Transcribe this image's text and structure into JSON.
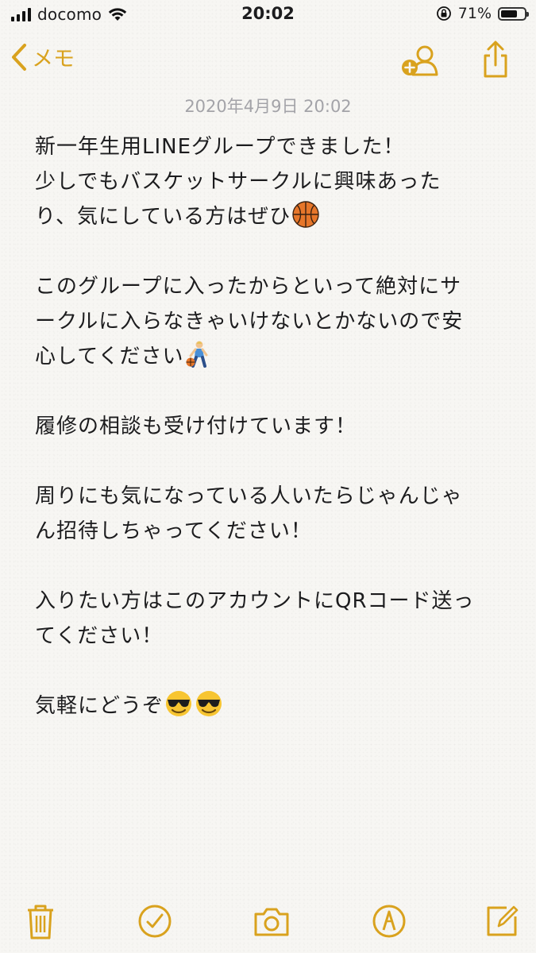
{
  "status_bar": {
    "carrier": "docomo",
    "time": "20:02",
    "battery_percent": "71%",
    "battery_level": 0.71,
    "signal_bars": 4
  },
  "nav": {
    "back_label": "メモ"
  },
  "note": {
    "date": "2020年4月9日 20:02",
    "paragraphs": [
      {
        "lines": [
          "新一年生用LINEグループできました！",
          "少しでもバスケットサークルに興味あった",
          "り、気にしている方はぜひ"
        ]
      },
      {
        "lines": [
          "このグループに入ったからといって絶対にサ",
          "ークルに入らなきゃいけないとかないので安",
          "心してください"
        ]
      },
      {
        "lines": [
          "履修の相談も受け付けています！"
        ]
      },
      {
        "lines": [
          "周りにも気になっている人いたらじゃんじゃ",
          "ん招待しちゃってください！"
        ]
      },
      {
        "lines": [
          "入りたい方はこのアカウントにQRコード送っ",
          "てください！"
        ]
      },
      {
        "lines": [
          "気軽にどうぞ"
        ]
      }
    ]
  },
  "icons": {
    "accent_color": "#d9a21e",
    "emoji_1": "basketball-emoji",
    "emoji_2": "person-bouncing-ball-emoji",
    "emoji_3": "smiling-face-with-sunglasses-emoji"
  }
}
